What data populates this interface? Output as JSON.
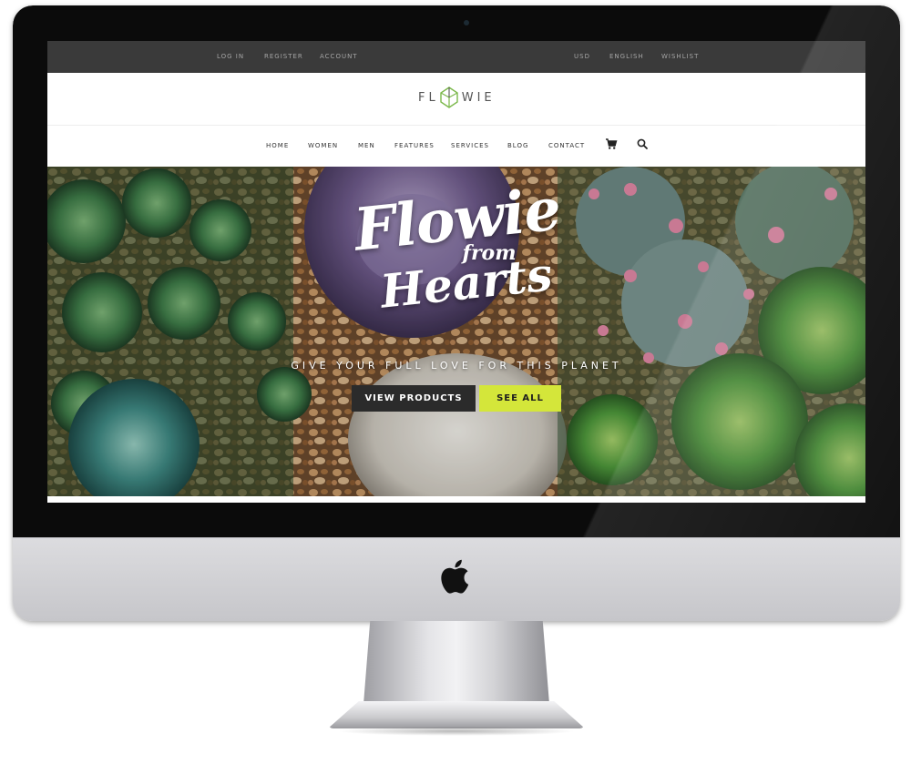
{
  "topbar": {
    "left_links": [
      "LOG IN",
      "REGISTER",
      "ACCOUNT"
    ],
    "right_links": [
      "USD",
      "ENGLISH",
      "WISHLIST"
    ]
  },
  "brand": {
    "logo_left": "FL",
    "logo_right": "WIE",
    "accent_color": "#7bb84a"
  },
  "nav": {
    "items": [
      "HOME",
      "WOMEN",
      "MEN",
      "FEATURES",
      "SERVICES",
      "BLOG",
      "CONTACT"
    ],
    "icons": [
      "cart-icon",
      "search-icon"
    ]
  },
  "hero": {
    "title_line1": "Flowie",
    "title_line2": "from",
    "title_line3": "Hearts",
    "tagline": "GIVE YOUR FULL LOVE FOR THIS PLANET",
    "primary_button": "VIEW PRODUCTS",
    "secondary_button": "SEE ALL",
    "button_colors": {
      "primary": "#2b2b2b",
      "secondary": "#d4e63a"
    }
  },
  "device": {
    "logo_icon": "apple-icon"
  }
}
